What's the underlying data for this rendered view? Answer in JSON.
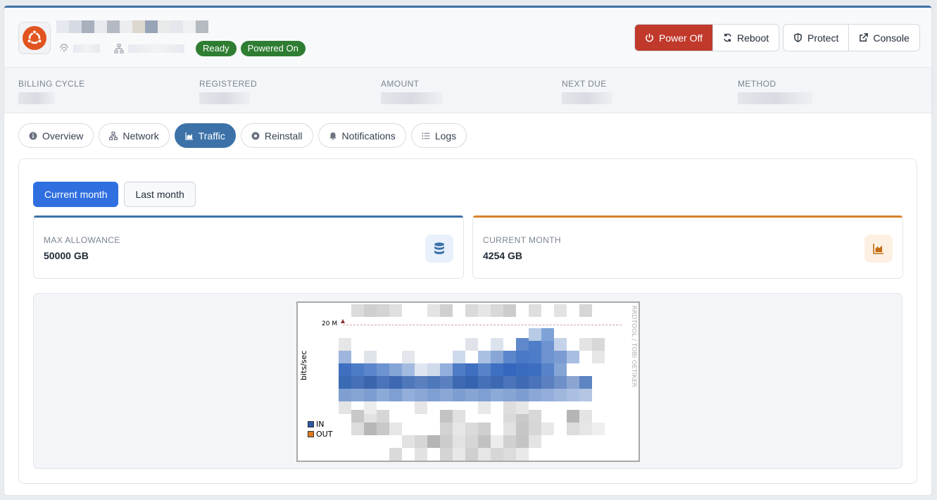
{
  "header": {
    "status_badges": [
      "Ready",
      "Powered On"
    ],
    "actions": {
      "power_off": "Power Off",
      "reboot": "Reboot",
      "protect": "Protect",
      "console": "Console"
    }
  },
  "billing": {
    "columns": [
      "BILLING CYCLE",
      "REGISTERED",
      "AMOUNT",
      "NEXT DUE",
      "METHOD"
    ]
  },
  "tabs": [
    "Overview",
    "Network",
    "Traffic",
    "Reinstall",
    "Notifications",
    "Logs"
  ],
  "active_tab": "Traffic",
  "traffic": {
    "period_buttons": [
      "Current month",
      "Last month"
    ],
    "active_period": "Current month",
    "max_allowance": {
      "label": "MAX ALLOWANCE",
      "value": "50000 GB"
    },
    "current_month": {
      "label": "CURRENT MONTH",
      "value": "4254 GB"
    },
    "graph": {
      "ylabel": "bits/sec",
      "y_top_tick": "20 M",
      "side_text": "RRDTOOL / TOBI OETIKER",
      "legend": [
        {
          "name": "IN",
          "color": "#2a5aa8"
        },
        {
          "name": "OUT",
          "color": "#e07820"
        }
      ]
    }
  },
  "colors": {
    "accent": "#3d72a8",
    "primary_button": "#2f6fe0",
    "danger": "#c0392b",
    "badge_green": "#2e7d32",
    "traffic_orange": "#d9822b"
  }
}
